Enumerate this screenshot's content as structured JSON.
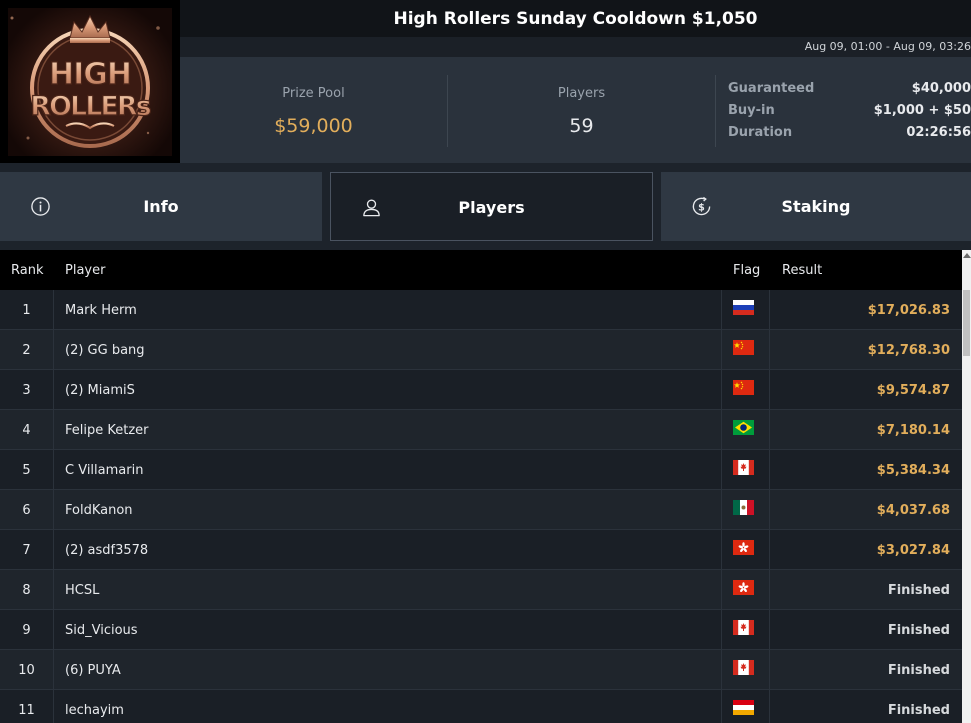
{
  "logo": {
    "text_top": "HIGH",
    "text_bottom": "ROLLERs"
  },
  "header": {
    "title": "High Rollers Sunday Cooldown $1,050",
    "date_range": "Aug 09, 01:00 - Aug 09, 03:26"
  },
  "stats": {
    "prize_pool_label": "Prize Pool",
    "prize_pool_value": "$59,000",
    "players_label": "Players",
    "players_value": "59",
    "guaranteed_label": "Guaranteed",
    "guaranteed_value": "$40,000",
    "buyin_label": "Buy-in",
    "buyin_value": "$1,000 + $50",
    "duration_label": "Duration",
    "duration_value": "02:26:56"
  },
  "tabs": [
    {
      "label": "Info",
      "icon": "info-icon",
      "active": false
    },
    {
      "label": "Players",
      "icon": "user-icon",
      "active": true
    },
    {
      "label": "Staking",
      "icon": "dollar-icon",
      "active": false
    }
  ],
  "table": {
    "columns": {
      "rank": "Rank",
      "player": "Player",
      "flag": "Flag",
      "result": "Result"
    },
    "rows": [
      {
        "rank": "1",
        "player": "Mark Herm",
        "flag": "russia",
        "result": "$17,026.83"
      },
      {
        "rank": "2",
        "player": "(2) GG bang",
        "flag": "china",
        "result": "$12,768.30"
      },
      {
        "rank": "3",
        "player": "(2) MiamiS",
        "flag": "china",
        "result": "$9,574.87"
      },
      {
        "rank": "4",
        "player": "Felipe Ketzer",
        "flag": "brazil",
        "result": "$7,180.14"
      },
      {
        "rank": "5",
        "player": "C Villamarin",
        "flag": "canada",
        "result": "$5,384.34"
      },
      {
        "rank": "6",
        "player": "FoldKanon",
        "flag": "mexico",
        "result": "$4,037.68"
      },
      {
        "rank": "7",
        "player": "(2) asdf3578",
        "flag": "hong-kong",
        "result": "$3,027.84"
      },
      {
        "rank": "8",
        "player": "HCSL",
        "flag": "hong-kong",
        "result": "Finished"
      },
      {
        "rank": "9",
        "player": "Sid_Vicious",
        "flag": "canada",
        "result": "Finished"
      },
      {
        "rank": "10",
        "player": "(6) PUYA",
        "flag": "canada",
        "result": "Finished"
      },
      {
        "rank": "11",
        "player": "lechayim",
        "flag": "armenia",
        "result": "Finished"
      }
    ]
  },
  "colors": {
    "accent_gold": "#e2ae5b",
    "background": "#1d232b",
    "title_bar": "#111418"
  }
}
